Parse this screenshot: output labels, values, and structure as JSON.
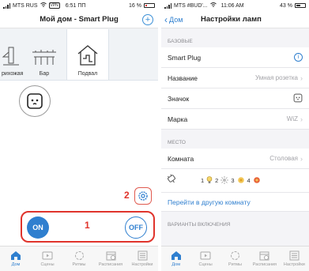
{
  "left": {
    "status": {
      "carrier": "MTS RUS",
      "network": "VPN",
      "time": "6:51 ПП",
      "battery": "16 %"
    },
    "nav": {
      "title": "Мой дом - Smart Plug"
    },
    "rooms": [
      {
        "label": "рихожая",
        "icon": "lamp-icon"
      },
      {
        "label": "Бар",
        "icon": "bar-icon"
      },
      {
        "label": "Подвал",
        "icon": "basement-icon",
        "active": true
      }
    ],
    "annotations": {
      "gear": "2",
      "controls": "1"
    },
    "controls": {
      "on": "ON",
      "off": "OFF"
    },
    "tabs": [
      "Дом",
      "Сцены",
      "Ритмы",
      "Расписания",
      "Настройки"
    ],
    "active_tab": "Дом"
  },
  "right": {
    "status": {
      "carrier": "MTS #BUD'...",
      "time": "11:06 AM",
      "battery": "43 %"
    },
    "nav": {
      "back": "Дом",
      "title": "Настройки ламп"
    },
    "sections": {
      "base": "БАЗОВЫЕ",
      "place": "МЕСТО",
      "variants": "ВАРИАНТЫ ВКЛЮЧЕНИЯ"
    },
    "rows": {
      "device": "Smart Plug",
      "name_label": "Название",
      "name_value": "Умная розетка",
      "icon_label": "Значок",
      "brand_label": "Марка",
      "brand_value": "WiZ",
      "room_label": "Комната",
      "room_value": "Столовая"
    },
    "lamps": [
      "1",
      "2",
      "3",
      "4"
    ],
    "link": "Перейти в другую комнату",
    "tabs": [
      "Дом",
      "Сцены",
      "Ритмы",
      "Расписания",
      "Настройки"
    ],
    "active_tab": "Дом"
  },
  "colors": {
    "accent": "#2f7fcf",
    "annotation_red": "#e0342c"
  }
}
